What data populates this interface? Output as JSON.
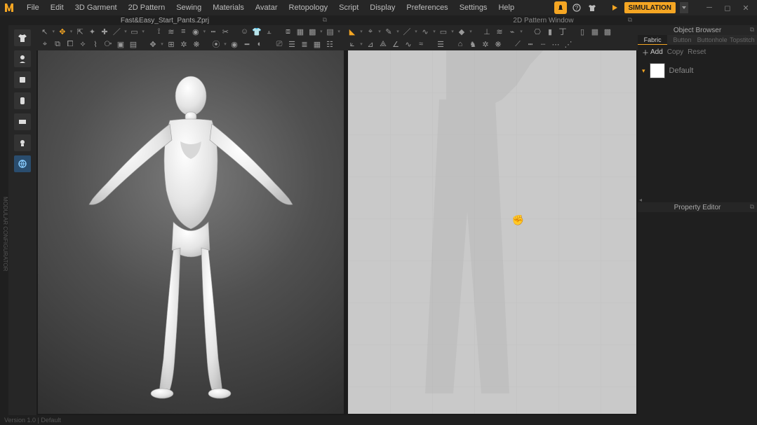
{
  "menu": {
    "items": [
      "File",
      "Edit",
      "3D Garment",
      "2D Pattern",
      "Sewing",
      "Materials",
      "Avatar",
      "Retopology",
      "Script",
      "Display",
      "Preferences",
      "Settings",
      "Help"
    ]
  },
  "titlebar": {
    "simulation_label": "SIMULATION"
  },
  "tabs": {
    "file_name": "Fast&Easy_Start_Pants.Zprj",
    "panel_2d": "2D Pattern Window",
    "object_browser": "Object Browser",
    "property_editor": "Property Editor"
  },
  "object_browser": {
    "tabs": [
      "Fabric",
      "Button",
      "Buttonhole",
      "Topstitch"
    ],
    "actions": {
      "add": "Add",
      "copy": "Copy",
      "reset": "Reset"
    },
    "fabric_default": "Default"
  },
  "sidebar": {
    "label": "MODULAR CONFIGURATOR"
  },
  "statusbar": {
    "text": "Version 1.0  |  Default"
  }
}
